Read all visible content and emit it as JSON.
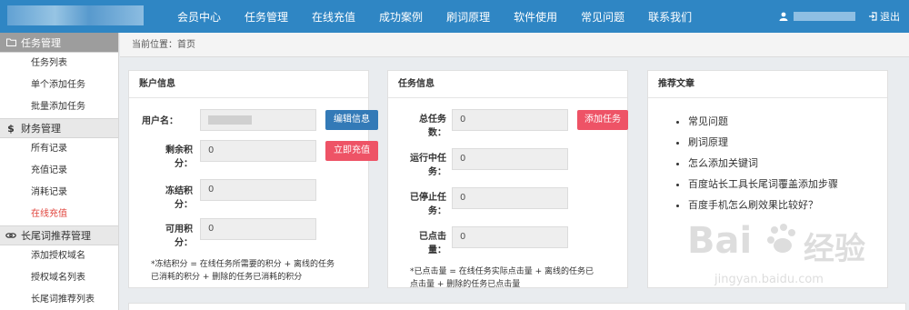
{
  "topbar": {
    "nav": [
      "会员中心",
      "任务管理",
      "在线充值",
      "成功案例",
      "刷词原理",
      "软件使用",
      "常见问题",
      "联系我们"
    ],
    "logout_label": "退出"
  },
  "sidebar": {
    "groups": [
      {
        "label": "任务管理",
        "icon": "folder-icon",
        "items": [
          "任务列表",
          "单个添加任务",
          "批量添加任务"
        ]
      },
      {
        "label": "财务管理",
        "icon": "dollar-icon",
        "items": [
          "所有记录",
          "充值记录",
          "消耗记录",
          "在线充值"
        ]
      },
      {
        "label": "长尾词推荐管理",
        "icon": "link-icon",
        "items": [
          "添加授权域名",
          "授权域名列表",
          "长尾词推荐列表"
        ]
      }
    ],
    "active_item": "在线充值"
  },
  "breadcrumb": "当前位置：首页",
  "account": {
    "title": "账户信息",
    "username_label": "用户名：",
    "balance_label_1": "剩余积",
    "balance_label_2": "分：",
    "balance_value": "0",
    "frozen_label_1": "冻结积",
    "frozen_label_2": "分：",
    "frozen_value": "0",
    "available_label_1": "可用积",
    "available_label_2": "分：",
    "available_value": "0",
    "edit_button": "编辑信息",
    "recharge_button": "立即充值",
    "note_1": "*冻结积分 = 在线任务所需要的积分 + 离线的任务",
    "note_2": "已消耗的积分 + 删除的任务已消耗的积分"
  },
  "tasks": {
    "title": "任务信息",
    "total_label_1": "总任务",
    "total_label_2": "数：",
    "total_value": "0",
    "running_label_1": "运行中任",
    "running_label_2": "务：",
    "running_value": "0",
    "stopped_label_1": "已停止任",
    "stopped_label_2": "务：",
    "stopped_value": "0",
    "clicked_label_1": "已点击",
    "clicked_label_2": "量：",
    "clicked_value": "0",
    "add_button": "添加任务",
    "note_1": "*已点击量 = 在线任务实际点击量 + 离线的任务已",
    "note_2": "点击量 + 删除的任务已点击量"
  },
  "recommend": {
    "title": "推荐文章",
    "articles": [
      "常见问题",
      "刷词原理",
      "怎么添加关键词",
      "百度站长工具长尾词覆盖添加步骤",
      "百度手机怎么刷效果比较好？"
    ]
  },
  "watermark": {
    "brand": "Bai",
    "brand_cn": "经验",
    "url": "jingyan.baidu.com"
  },
  "colors": {
    "topbar": "#2f86c4",
    "primary_button": "#337ab7",
    "danger_button": "#ee5366",
    "active_link": "#e0443c"
  }
}
